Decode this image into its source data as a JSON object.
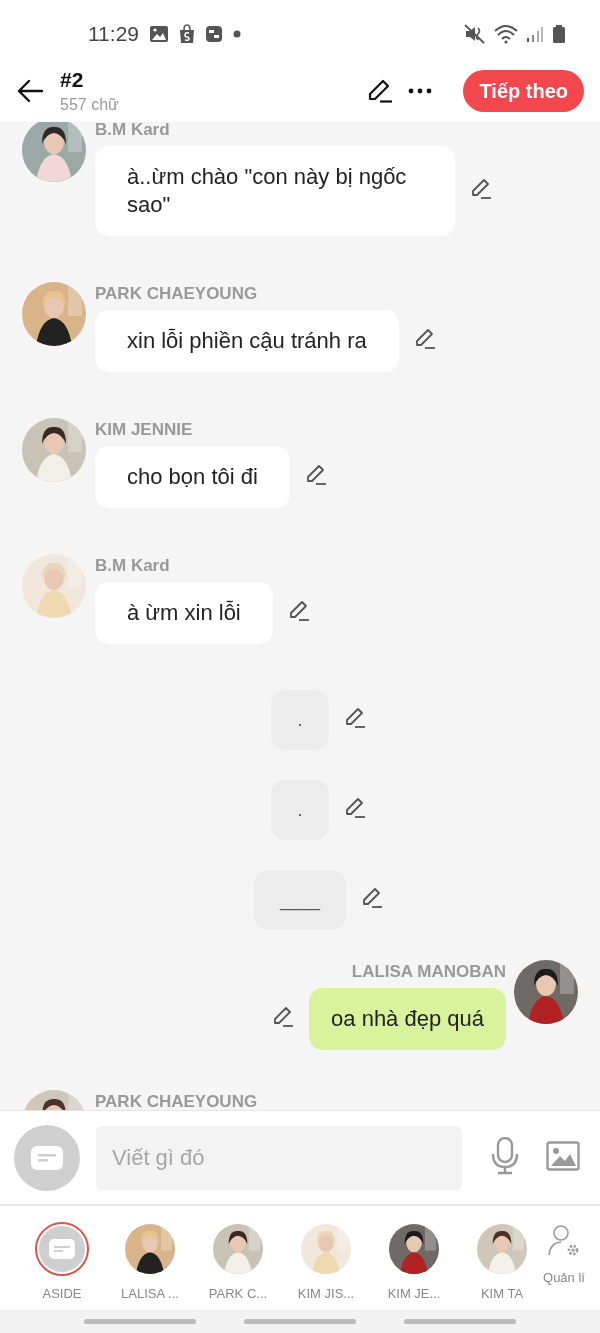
{
  "status_bar": {
    "time": "11:29"
  },
  "header": {
    "title": "#2",
    "subtitle": "557 chữ",
    "next_button": "Tiếp theo"
  },
  "messages": [
    {
      "kind": "character",
      "name": "B.M Kard",
      "text": "à..ừm chào \"con này bị ngốc sao\""
    },
    {
      "kind": "character",
      "name": "PARK CHAEYOUNG",
      "text": "xin lỗi phiền cậu tránh ra"
    },
    {
      "kind": "character",
      "name": "KIM JENNIE",
      "text": "cho bọn tôi đi"
    },
    {
      "kind": "character",
      "name": "B.M Kard",
      "text": "à ừm xin lỗi"
    },
    {
      "kind": "narration",
      "text": "."
    },
    {
      "kind": "narration",
      "text": "."
    },
    {
      "kind": "narration",
      "text": "____"
    },
    {
      "kind": "self",
      "name": "LALISA MANOBAN",
      "text": "oa nhà đẹp quá"
    },
    {
      "kind": "character",
      "name": "PARK CHAEYOUNG"
    }
  ],
  "composer": {
    "placeholder": "Viết gì đó"
  },
  "cast": [
    {
      "kind": "aside",
      "label": "ASIDE",
      "selected": true
    },
    {
      "kind": "character",
      "label": "LALISA ...",
      "selected": false
    },
    {
      "kind": "character",
      "label": "PARK C...",
      "selected": false
    },
    {
      "kind": "character",
      "label": "KIM JIS...",
      "selected": false
    },
    {
      "kind": "character",
      "label": "KIM JE...",
      "selected": false
    },
    {
      "kind": "character",
      "label": "KIM TA",
      "selected": false
    }
  ],
  "manage": {
    "label": "Quản lí"
  }
}
